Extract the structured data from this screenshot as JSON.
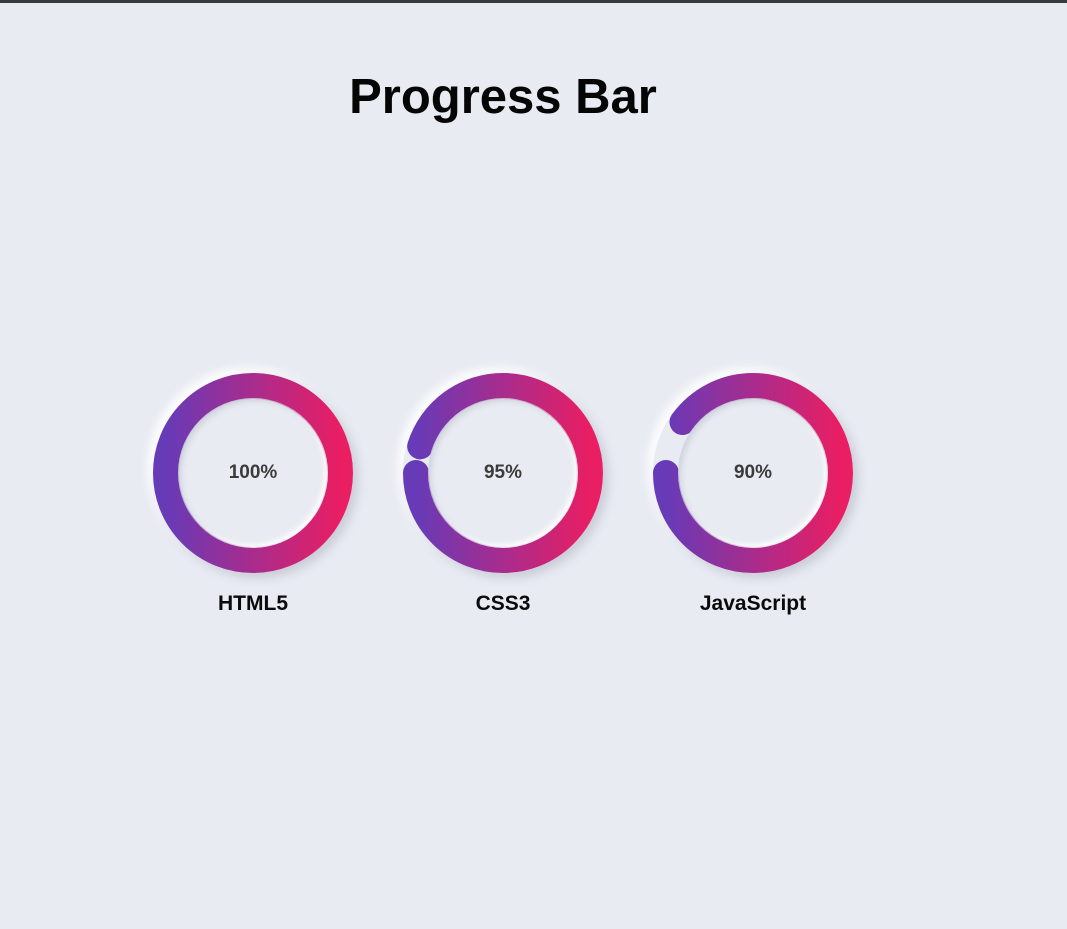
{
  "page": {
    "title": "Progress Bar"
  },
  "colors": {
    "background": "#e8ebf2",
    "gradient_start": "#e91e63",
    "gradient_end": "#673ab7",
    "track": "#e8ebf2"
  },
  "skills": [
    {
      "label": "HTML5",
      "percent_text": "100%",
      "percent": 100
    },
    {
      "label": "CSS3",
      "percent_text": "95%",
      "percent": 95
    },
    {
      "label": "JavaScript",
      "percent_text": "90%",
      "percent": 90
    }
  ]
}
